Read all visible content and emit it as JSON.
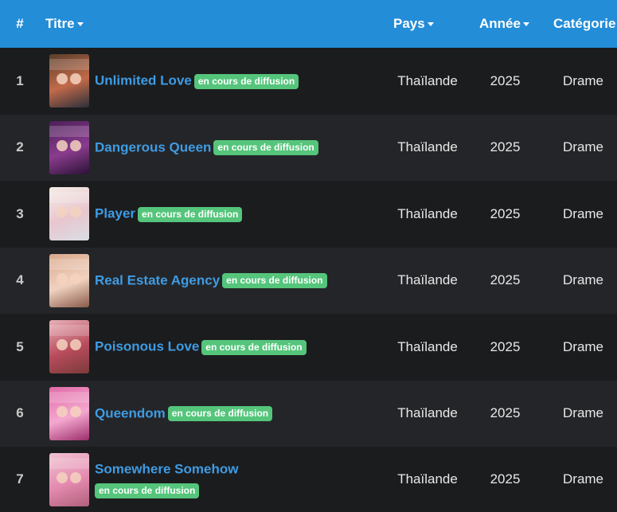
{
  "header": {
    "num": "#",
    "title": "Titre",
    "country": "Pays",
    "year": "Année",
    "category": "Catégorie"
  },
  "rows": [
    {
      "rank": "1",
      "title": "Unlimited Love",
      "badge": "en cours de diffusion",
      "country": "Thaïlande",
      "year": "2025",
      "category": "Drame",
      "poster_colors": [
        "#5a3e2a",
        "#c26a4a",
        "#2b2f3a"
      ]
    },
    {
      "rank": "2",
      "title": "Dangerous Queen",
      "badge": "en cours de diffusion",
      "country": "Thaïlande",
      "year": "2025",
      "category": "Drame",
      "poster_colors": [
        "#4b1f57",
        "#8a3c8e",
        "#2a1235"
      ]
    },
    {
      "rank": "3",
      "title": "Player",
      "badge": "en cours de diffusion",
      "country": "Thaïlande",
      "year": "2025",
      "category": "Drame",
      "poster_colors": [
        "#f3ece6",
        "#e9c6cf",
        "#d9dde4"
      ]
    },
    {
      "rank": "4",
      "title": "Real Estate Agency",
      "badge": "en cours de diffusion",
      "country": "Thaïlande",
      "year": "2025",
      "category": "Drame",
      "poster_colors": [
        "#d9a88b",
        "#f0d2c0",
        "#8a5a4a"
      ]
    },
    {
      "rank": "5",
      "title": "Poisonous Love",
      "badge": "en cours de diffusion",
      "country": "Thaïlande",
      "year": "2025",
      "category": "Drame",
      "poster_colors": [
        "#e8b0b8",
        "#b84c5c",
        "#7a3a3a"
      ]
    },
    {
      "rank": "6",
      "title": "Queendom",
      "badge": "en cours de diffusion",
      "country": "Thaïlande",
      "year": "2025",
      "category": "Drame",
      "poster_colors": [
        "#e06aa8",
        "#f4a8cf",
        "#9c2e6c"
      ]
    },
    {
      "rank": "7",
      "title": "Somewhere Somehow",
      "badge": "en cours de diffusion",
      "country": "Thaïlande",
      "year": "2025",
      "category": "Drame",
      "poster_colors": [
        "#f0c2d0",
        "#e48ab0",
        "#b0607a"
      ]
    }
  ]
}
